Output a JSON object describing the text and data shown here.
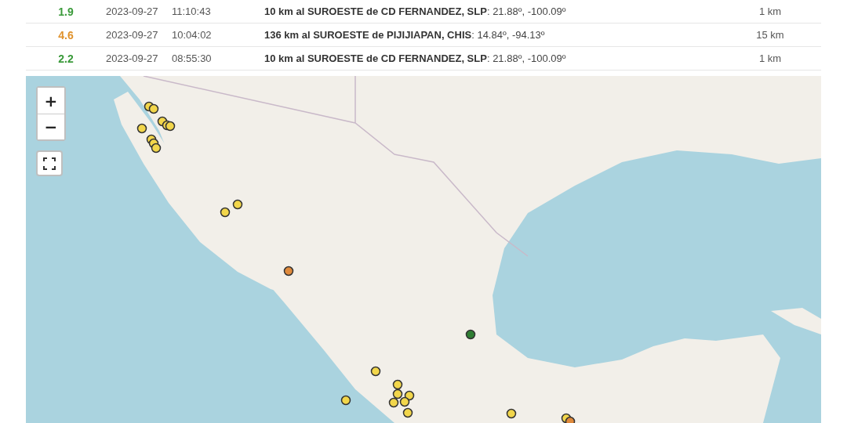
{
  "table": {
    "rows": [
      {
        "magnitude": "1.9",
        "color": "#3a9a3a",
        "date": "2023-09-27",
        "time": "11:10:43",
        "location": "**10 km al SUROESTE de CD FERNANDEZ, SLP**: 21.88º, -100.09º",
        "depth": "1 km"
      },
      {
        "magnitude": "4.6",
        "color": "#e0922c",
        "date": "2023-09-27",
        "time": "10:04:02",
        "location": "**136 km al SUROESTE de PIJIJIAPAN, CHIS**: 14.84º, -94.13º",
        "depth": "15 km"
      },
      {
        "magnitude": "2.2",
        "color": "#3a9a3a",
        "date": "2023-09-27",
        "time": "08:55:30",
        "location": "**10 km al SUROESTE de CD FERNANDEZ, SLP**: 21.88º, -100.09º",
        "depth": "1 km"
      }
    ]
  },
  "map": {
    "zoom_in": "+",
    "zoom_out": "−",
    "markers": [
      {
        "color": "#f2d64b"
      },
      {
        "color": "#f2d64b"
      },
      {
        "color": "#f2d64b"
      },
      {
        "color": "#f2d64b"
      },
      {
        "color": "#f2d64b"
      },
      {
        "color": "#f2d64b"
      },
      {
        "color": "#f2d64b"
      },
      {
        "color": "#f2d64b"
      },
      {
        "color": "#f2d64b"
      },
      {
        "color": "#f2d64b"
      },
      {
        "color": "#f2d64b"
      },
      {
        "color": "#e08a3c"
      },
      {
        "color": "#2e7d32"
      },
      {
        "color": "#f2d64b"
      },
      {
        "color": "#f2d64b"
      },
      {
        "color": "#f2d64b"
      },
      {
        "color": "#f2d64b"
      },
      {
        "color": "#f2d64b"
      },
      {
        "color": "#f2d64b"
      },
      {
        "color": "#f2d64b"
      },
      {
        "color": "#f2d64b"
      },
      {
        "color": "#f2d64b"
      },
      {
        "color": "#f2d64b"
      },
      {
        "color": "#e08a3c"
      }
    ]
  }
}
